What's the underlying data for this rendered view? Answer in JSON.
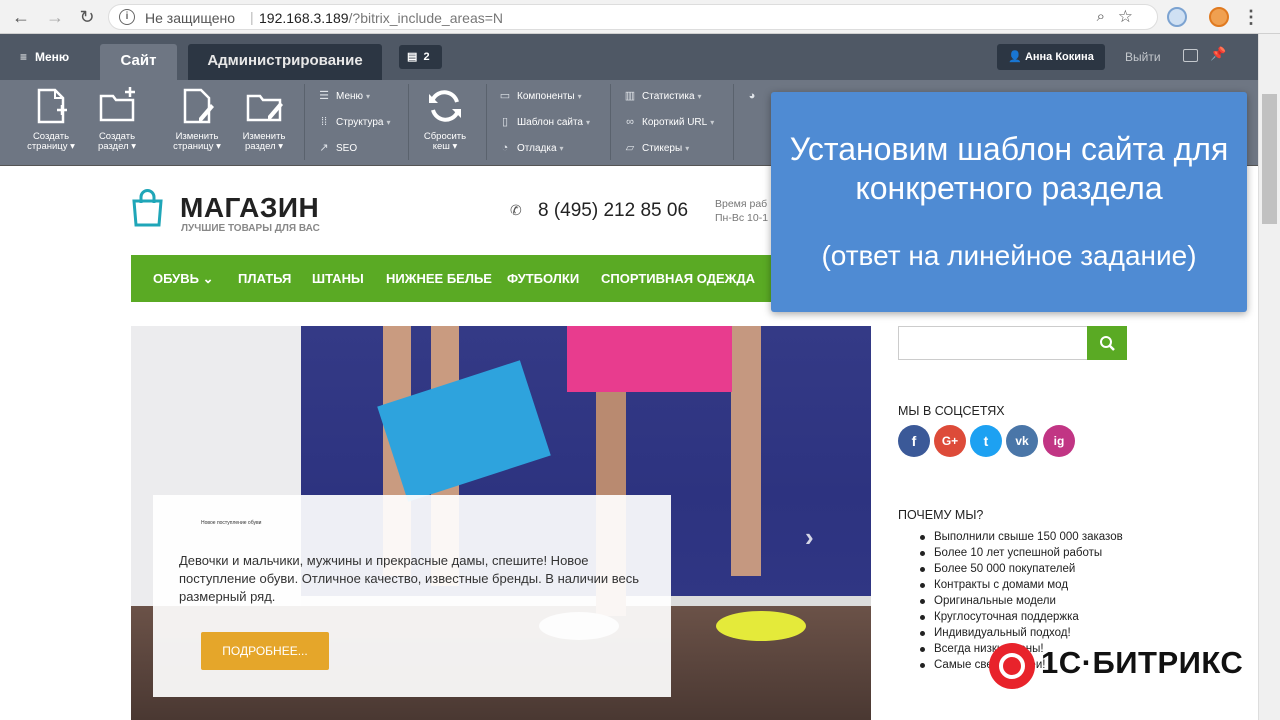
{
  "browser": {
    "security": "Не защищено",
    "url_host": "192.168.3.189",
    "url_path": "/?bitrix_include_areas=N"
  },
  "admin": {
    "menu_label": "Меню",
    "tab_site": "Сайт",
    "tab_admin": "Администрирование",
    "notifications_count": "2",
    "user_name": "Анна Кокина",
    "logout": "Выйти",
    "big_tools": [
      {
        "line1": "Создать",
        "line2": "страницу"
      },
      {
        "line1": "Создать",
        "line2": "раздел"
      },
      {
        "line1": "Изменить",
        "line2": "страницу"
      },
      {
        "line1": "Изменить",
        "line2": "раздел"
      },
      {
        "line1": "Сбросить",
        "line2": "кеш"
      }
    ],
    "small_tools": [
      "Меню",
      "Структура",
      "SEO",
      "Компоненты",
      "Шаблон сайта",
      "Отладка",
      "Статистика",
      "Короткий URL",
      "Стикеры"
    ]
  },
  "site": {
    "logo_name": "МАГАЗИН",
    "logo_tagline": "ЛУЧШИЕ ТОВАРЫ ДЛЯ ВАС",
    "phone": "8 (495) 212 85 06",
    "worktime_line1": "Время раб",
    "worktime_line2": "Пн-Вс 10-1",
    "nav": [
      "ОБУВЬ",
      "ПЛАТЬЯ",
      "ШТАНЫ",
      "НИЖНЕЕ БЕЛЬЕ",
      "ФУТБОЛКИ",
      "СПОРТИВНАЯ ОДЕЖДА"
    ],
    "banner": {
      "small_caption": "Новое поступление обуви",
      "text": "Девочки и мальчики, мужчины и прекрасные дамы, спешите! Новое поступление обуви. Отличное качество, известные бренды. В наличии весь размерный ряд.",
      "button": "ПОДРОБНЕЕ..."
    },
    "social_title": "МЫ В СОЦСЕТЯХ",
    "social": [
      "f",
      "G+",
      "t",
      "vk",
      "ig"
    ],
    "why_title": "ПОЧЕМУ МЫ?",
    "why_items": [
      "Выполнили свыше 150 000 заказов",
      "Более 10 лет успешной работы",
      "Более 50 000 покупателей",
      "Контракты с домами мод",
      "Оригинальные модели",
      "Круглосуточная поддержка",
      "Индивидуальный подход!",
      "Всегда низкие цены!",
      "Самые свежие идеи!"
    ]
  },
  "overlay": {
    "title": "Установим шаблон сайта для конкретного раздела",
    "subtitle": "(ответ на линейное задание)"
  },
  "brand": {
    "bitrix_text": "1С·БИТРИКС"
  },
  "colors": {
    "green": "#5aaa24",
    "overlay_blue": "#4f8bd3",
    "admin_dark": "#2c3643",
    "bitrix_red": "#e8232b",
    "button_orange": "#e5a62a"
  }
}
